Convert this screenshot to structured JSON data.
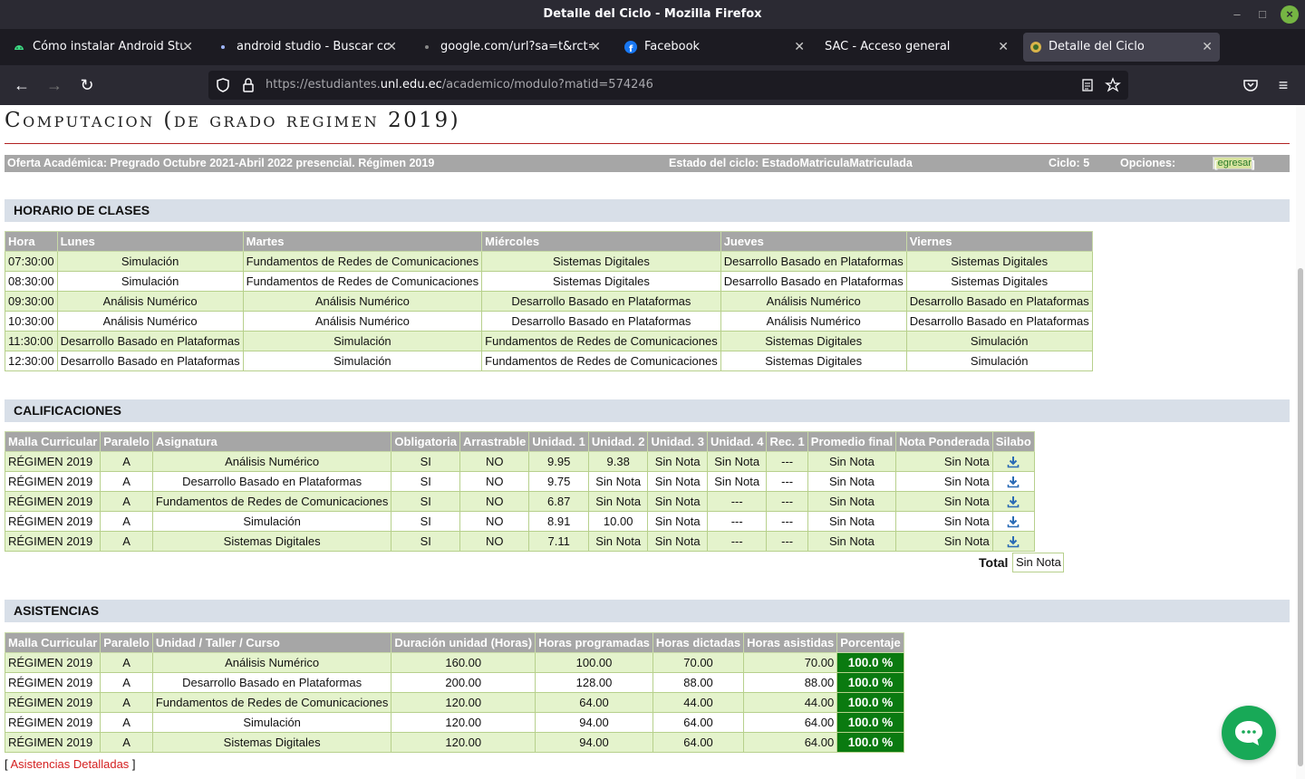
{
  "window": {
    "title": "Detalle del Ciclo - Mozilla Firefox"
  },
  "tabs": [
    {
      "label": "Cómo instalar Android Studio"
    },
    {
      "label": "android studio - Buscar con"
    },
    {
      "label": "google.com/url?sa=t&rct=j&"
    },
    {
      "label": "Facebook"
    },
    {
      "label": "SAC - Acceso general"
    },
    {
      "label": "Detalle del Ciclo"
    }
  ],
  "url": {
    "prefix": "https://estudiantes.",
    "domain": "unl.edu.ec",
    "path": "/academico/modulo?matid=574246"
  },
  "page": {
    "heading": "Computacion (de grado regimen 2019)",
    "info": {
      "oferta": "Oferta Académica: Pregrado Octubre 2021-Abril 2022 presencial. Régimen 2019",
      "estado": "Estado del ciclo: EstadoMatriculaMatriculada",
      "ciclo": "Ciclo: 5",
      "opciones": "Opciones:",
      "regresar": "regresar",
      "bracket_open": "[",
      "bracket_close": "]"
    }
  },
  "horario": {
    "title": "HORARIO DE CLASES",
    "headers": [
      "Hora",
      "Lunes",
      "Martes",
      "Miércoles",
      "Jueves",
      "Viernes"
    ],
    "rows": [
      [
        "07:30:00",
        "Simulación",
        "Fundamentos de Redes de Comunicaciones",
        "Sistemas Digitales",
        "Desarrollo Basado en Plataformas",
        "Sistemas Digitales"
      ],
      [
        "08:30:00",
        "Simulación",
        "Fundamentos de Redes de Comunicaciones",
        "Sistemas Digitales",
        "Desarrollo Basado en Plataformas",
        "Sistemas Digitales"
      ],
      [
        "09:30:00",
        "Análisis Numérico",
        "Análisis Numérico",
        "Desarrollo Basado en Plataformas",
        "Análisis Numérico",
        "Desarrollo Basado en Plataformas"
      ],
      [
        "10:30:00",
        "Análisis Numérico",
        "Análisis Numérico",
        "Desarrollo Basado en Plataformas",
        "Análisis Numérico",
        "Desarrollo Basado en Plataformas"
      ],
      [
        "11:30:00",
        "Desarrollo Basado en Plataformas",
        "Simulación",
        "Fundamentos de Redes de Comunicaciones",
        "Sistemas Digitales",
        "Simulación"
      ],
      [
        "12:30:00",
        "Desarrollo Basado en Plataformas",
        "Simulación",
        "Fundamentos de Redes de Comunicaciones",
        "Sistemas Digitales",
        "Simulación"
      ]
    ]
  },
  "calificaciones": {
    "title": "CALIFICACIONES",
    "headers": [
      "Malla Curricular",
      "Paralelo",
      "Asignatura",
      "Obligatoria",
      "Arrastrable",
      "Unidad. 1",
      "Unidad. 2",
      "Unidad. 3",
      "Unidad. 4",
      "Rec. 1",
      "Promedio final",
      "Nota Ponderada",
      "Silabo"
    ],
    "rows": [
      [
        "RÉGIMEN 2019",
        "A",
        "Análisis Numérico",
        "SI",
        "NO",
        "9.95",
        "9.38",
        "Sin Nota",
        "Sin Nota",
        "---",
        "Sin Nota",
        "Sin Nota"
      ],
      [
        "RÉGIMEN 2019",
        "A",
        "Desarrollo Basado en Plataformas",
        "SI",
        "NO",
        "9.75",
        "Sin Nota",
        "Sin Nota",
        "Sin Nota",
        "---",
        "Sin Nota",
        "Sin Nota"
      ],
      [
        "RÉGIMEN 2019",
        "A",
        "Fundamentos de Redes de Comunicaciones",
        "SI",
        "NO",
        "6.87",
        "Sin Nota",
        "Sin Nota",
        "---",
        "---",
        "Sin Nota",
        "Sin Nota"
      ],
      [
        "RÉGIMEN 2019",
        "A",
        "Simulación",
        "SI",
        "NO",
        "8.91",
        "10.00",
        "Sin Nota",
        "---",
        "---",
        "Sin Nota",
        "Sin Nota"
      ],
      [
        "RÉGIMEN 2019",
        "A",
        "Sistemas Digitales",
        "SI",
        "NO",
        "7.11",
        "Sin Nota",
        "Sin Nota",
        "---",
        "---",
        "Sin Nota",
        "Sin Nota"
      ]
    ],
    "total_label": "Total",
    "total_value": "Sin Nota"
  },
  "asistencias": {
    "title": "ASISTENCIAS",
    "headers": [
      "Malla Curricular",
      "Paralelo",
      "Unidad / Taller / Curso",
      "Duración unidad (Horas)",
      "Horas programadas",
      "Horas dictadas",
      "Horas asistidas",
      "Porcentaje"
    ],
    "rows": [
      [
        "RÉGIMEN 2019",
        "A",
        "Análisis Numérico",
        "160.00",
        "100.00",
        "70.00",
        "70.00",
        "100.0 %"
      ],
      [
        "RÉGIMEN 2019",
        "A",
        "Desarrollo Basado en Plataformas",
        "200.00",
        "128.00",
        "88.00",
        "88.00",
        "100.0 %"
      ],
      [
        "RÉGIMEN 2019",
        "A",
        "Fundamentos de Redes de Comunicaciones",
        "120.00",
        "64.00",
        "44.00",
        "44.00",
        "100.0 %"
      ],
      [
        "RÉGIMEN 2019",
        "A",
        "Simulación",
        "120.00",
        "94.00",
        "64.00",
        "64.00",
        "100.0 %"
      ],
      [
        "RÉGIMEN 2019",
        "A",
        "Sistemas Digitales",
        "120.00",
        "94.00",
        "64.00",
        "64.00",
        "100.0 %"
      ]
    ],
    "link_open": "[ ",
    "link_label": "Asistencias Detalladas",
    "link_close": " ]"
  },
  "colors": {
    "row_green": "#e4f3cc",
    "header_gray": "#a6a6a6",
    "percent_green": "#0a7a10",
    "accent_red": "#b22222"
  }
}
